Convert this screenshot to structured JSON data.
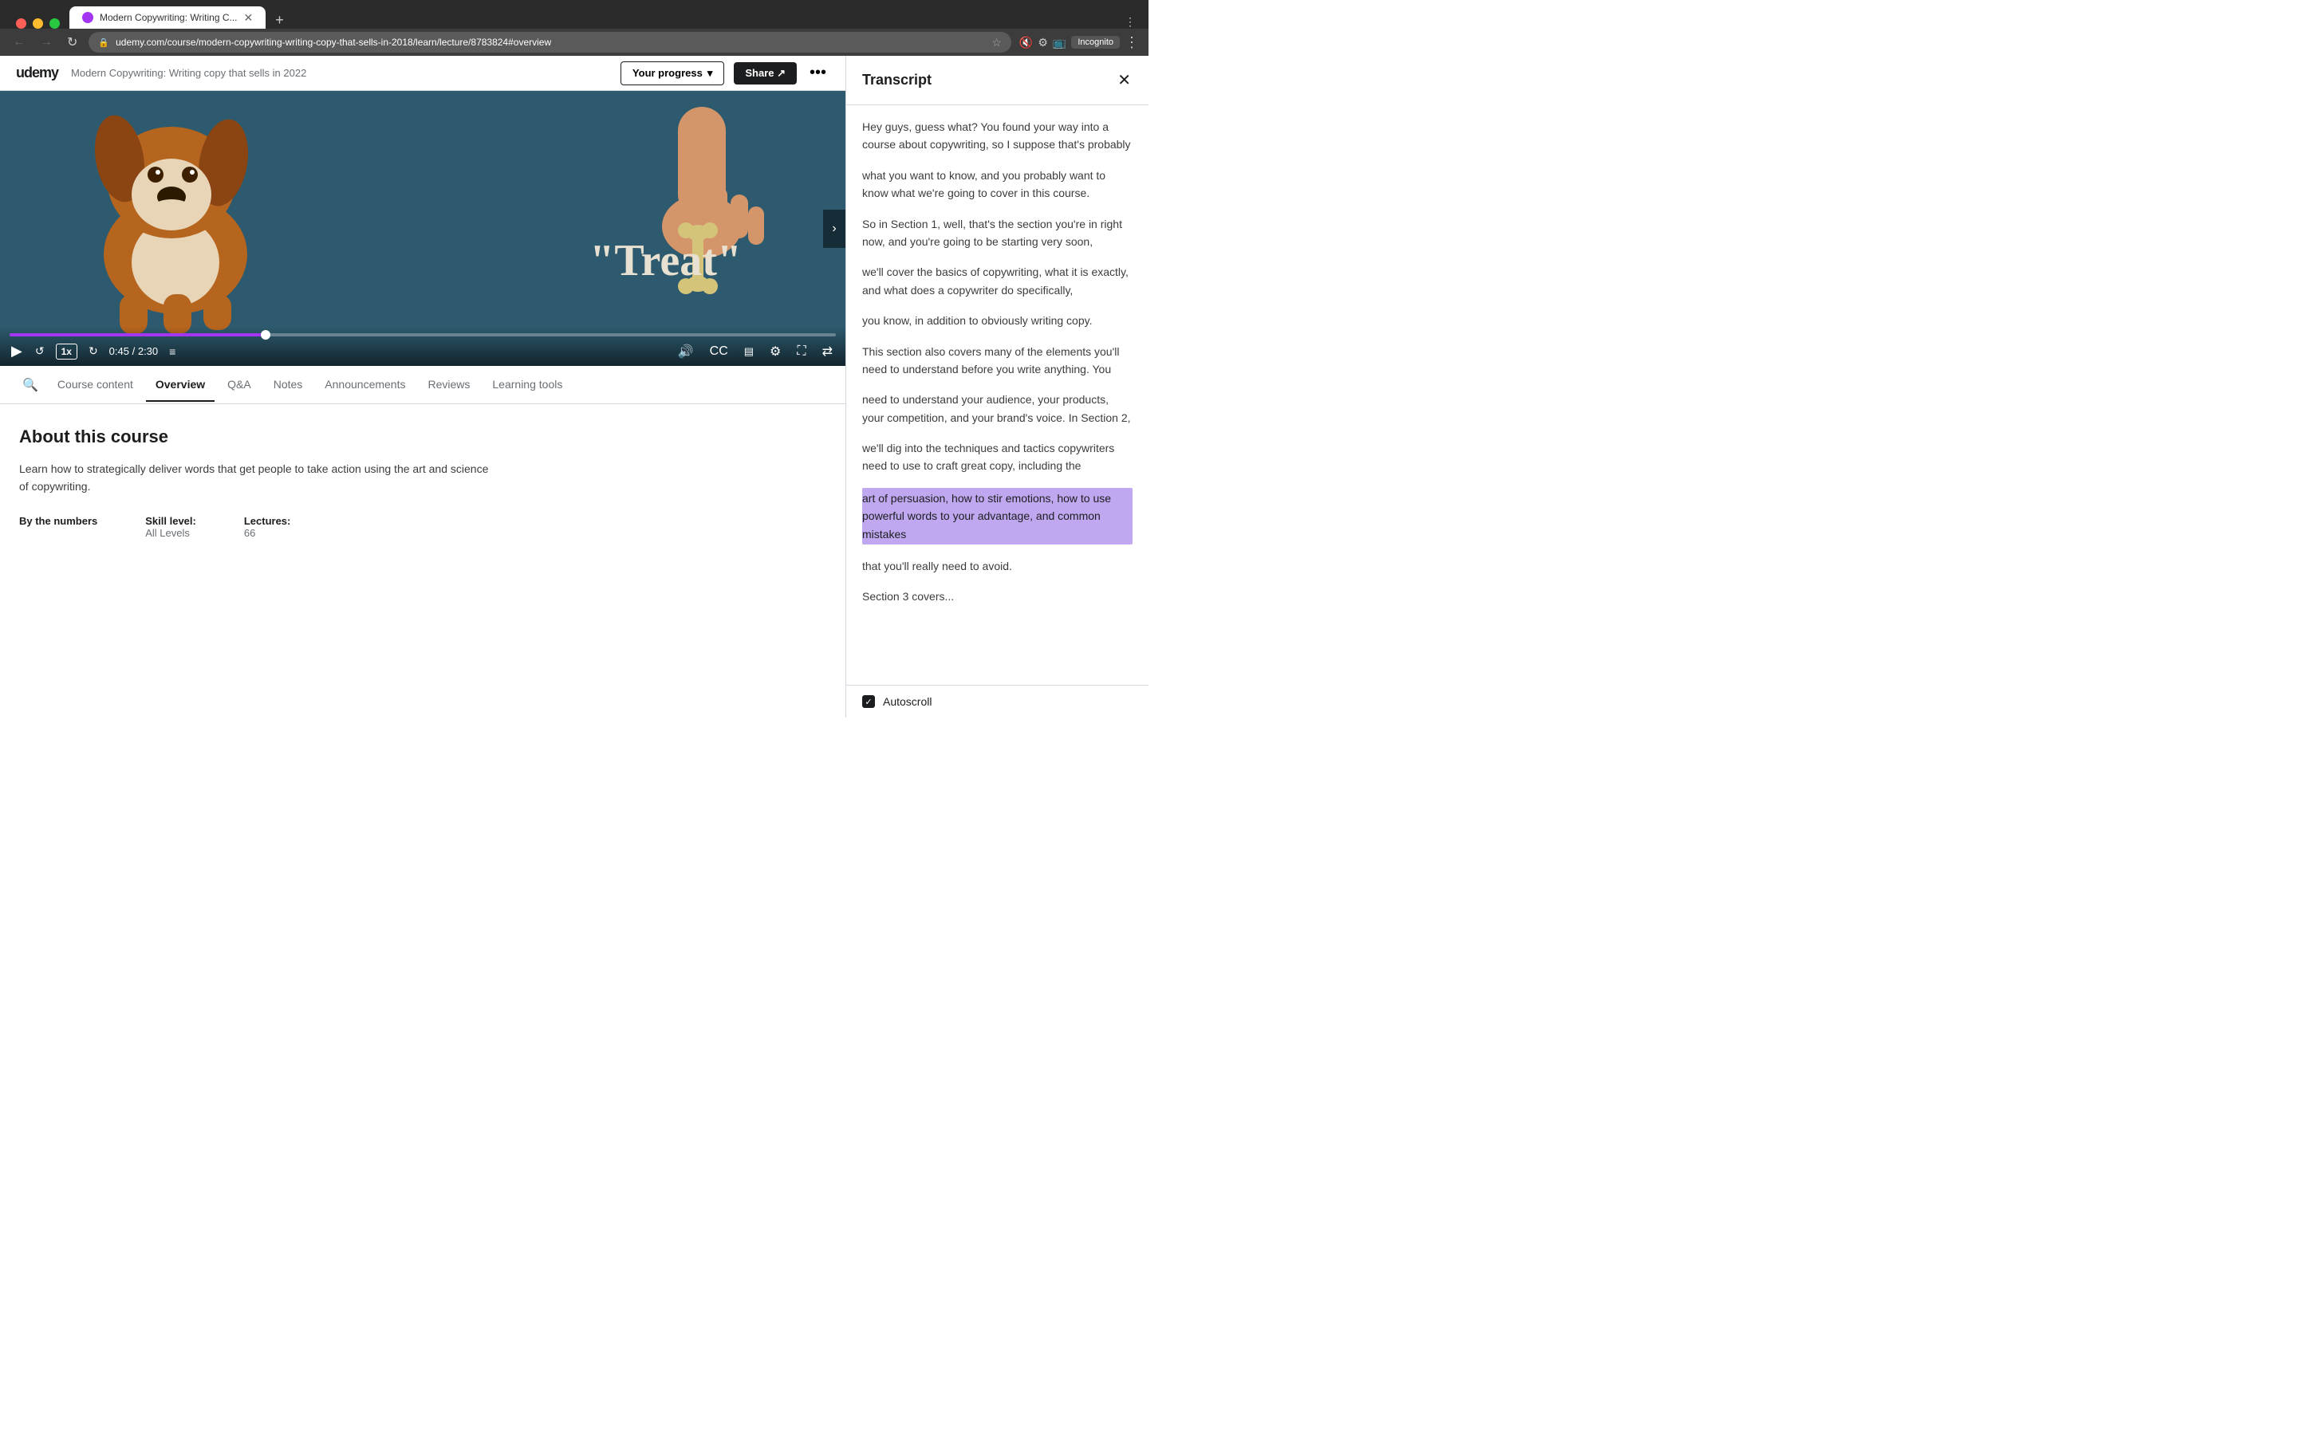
{
  "browser": {
    "tab_title": "Modern Copywriting: Writing C...",
    "tab_favicon_color": "#a435f0",
    "url": "udemy.com/course/modern-copywriting-writing-copy-that-sells-in-2018/learn/lecture/8783824#overview",
    "incognito_label": "Incognito"
  },
  "udemy_header": {
    "logo": "udemy",
    "course_title": "Modern Copywriting: Writing copy that sells in 2022",
    "progress_label": "Your progress",
    "share_label": "Share ↗"
  },
  "video": {
    "treat_text": "\"Treat\"",
    "time_current": "0:45",
    "time_total": "2:30",
    "speed": "1x"
  },
  "tabs": {
    "search_icon": "🔍",
    "items": [
      {
        "label": "Course content",
        "active": false
      },
      {
        "label": "Overview",
        "active": true
      },
      {
        "label": "Q&A",
        "active": false
      },
      {
        "label": "Notes",
        "active": false
      },
      {
        "label": "Announcements",
        "active": false
      },
      {
        "label": "Reviews",
        "active": false
      },
      {
        "label": "Learning tools",
        "active": false
      }
    ]
  },
  "content": {
    "about_title": "About this course",
    "about_desc": "Learn how to strategically deliver words that get people to take action using the art and science of copywriting.",
    "by_numbers_label": "By the numbers",
    "skill_level_label": "Skill level:",
    "skill_level_value": "All Levels",
    "lectures_label": "Lectures:",
    "lectures_value": "66"
  },
  "transcript": {
    "title": "Transcript",
    "close_icon": "✕",
    "paragraphs": [
      {
        "text": "Hey guys, guess what? You found your way into a course about copywriting, so I suppose that's probably",
        "highlighted": false
      },
      {
        "text": "what you want to know, and you probably want to know what we're going to cover in this course.",
        "highlighted": false
      },
      {
        "text": "So in Section 1, well, that's the section you're in right now, and you're going to be starting very soon,",
        "highlighted": false
      },
      {
        "text": "we'll cover the basics of copywriting, what it is exactly, and what does a copywriter do specifically,",
        "highlighted": false
      },
      {
        "text": "you know, in addition to obviously writing copy.",
        "highlighted": false
      },
      {
        "text": "This section also covers many of the elements you'll need to understand before you write anything. You",
        "highlighted": false
      },
      {
        "text": "need to understand your audience, your products, your competition, and your brand's voice. In Section 2,",
        "highlighted": false
      },
      {
        "text": "we'll dig into the techniques and tactics copywriters need to use to craft great copy, including the",
        "highlighted": false
      },
      {
        "text": "art of persuasion, how to stir emotions, how to use powerful words to your advantage, and common mistakes",
        "highlighted": true
      },
      {
        "text": "that you'll really need to avoid.",
        "highlighted": false
      },
      {
        "text": "Section 3 covers...",
        "highlighted": false
      }
    ],
    "autoscroll_label": "Autoscroll",
    "autoscroll_checked": true
  }
}
